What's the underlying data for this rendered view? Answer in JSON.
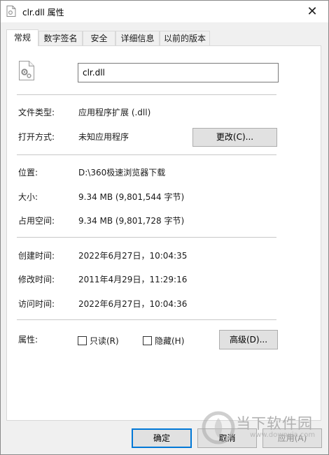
{
  "window": {
    "title": "clr.dll 属性",
    "close_glyph": "✕"
  },
  "tabs": [
    {
      "label": "常规",
      "active": true
    },
    {
      "label": "数字签名",
      "active": false
    },
    {
      "label": "安全",
      "active": false
    },
    {
      "label": "详细信息",
      "active": false
    },
    {
      "label": "以前的版本",
      "active": false
    }
  ],
  "file": {
    "name": "clr.dll",
    "icon": "dll-file-icon"
  },
  "type": {
    "label": "文件类型:",
    "value": "应用程序扩展 (.dll)"
  },
  "opens_with": {
    "label": "打开方式:",
    "value": "未知应用程序",
    "change_button": "更改(C)..."
  },
  "location": {
    "label": "位置:",
    "value": "D:\\360极速浏览器下载"
  },
  "size": {
    "label": "大小:",
    "value": "9.34 MB (9,801,544 字节)"
  },
  "size_on_disk": {
    "label": "占用空间:",
    "value": "9.34 MB (9,801,728 字节)"
  },
  "created": {
    "label": "创建时间:",
    "value": "2022年6月27日，10:04:35"
  },
  "modified": {
    "label": "修改时间:",
    "value": "2011年4月29日，11:29:16"
  },
  "accessed": {
    "label": "访问时间:",
    "value": "2022年6月27日，10:04:36"
  },
  "attributes": {
    "label": "属性:",
    "readonly": {
      "label": "只读(R)",
      "checked": false
    },
    "hidden": {
      "label": "隐藏(H)",
      "checked": false
    },
    "advanced_button": "高级(D)..."
  },
  "footer": {
    "ok": "确定",
    "cancel": "取消",
    "apply": "应用(A)"
  },
  "watermark": {
    "brand": "当下软件园",
    "url": "www.downxia.com"
  }
}
